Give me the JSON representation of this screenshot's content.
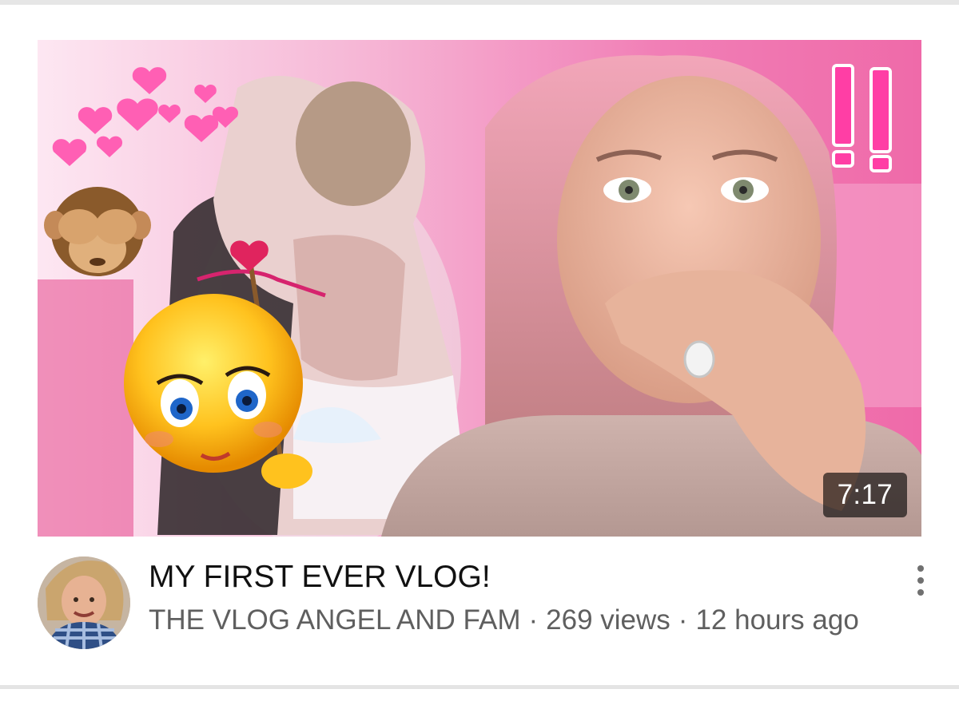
{
  "video": {
    "title": "MY FIRST EVER VLOG!",
    "duration": "7:17",
    "channel": "THE VLOG ANGEL AND FAM",
    "views": "269 views",
    "published": "12 hours ago",
    "separator": "·"
  },
  "thumbnail": {
    "overlay_text": "!!",
    "dominant_color": "#f06aa8",
    "icons": [
      "heart-icon",
      "see-no-evil-monkey-icon",
      "cupid-emoji-icon"
    ]
  },
  "menu": {
    "icon": "more-vertical-icon"
  }
}
